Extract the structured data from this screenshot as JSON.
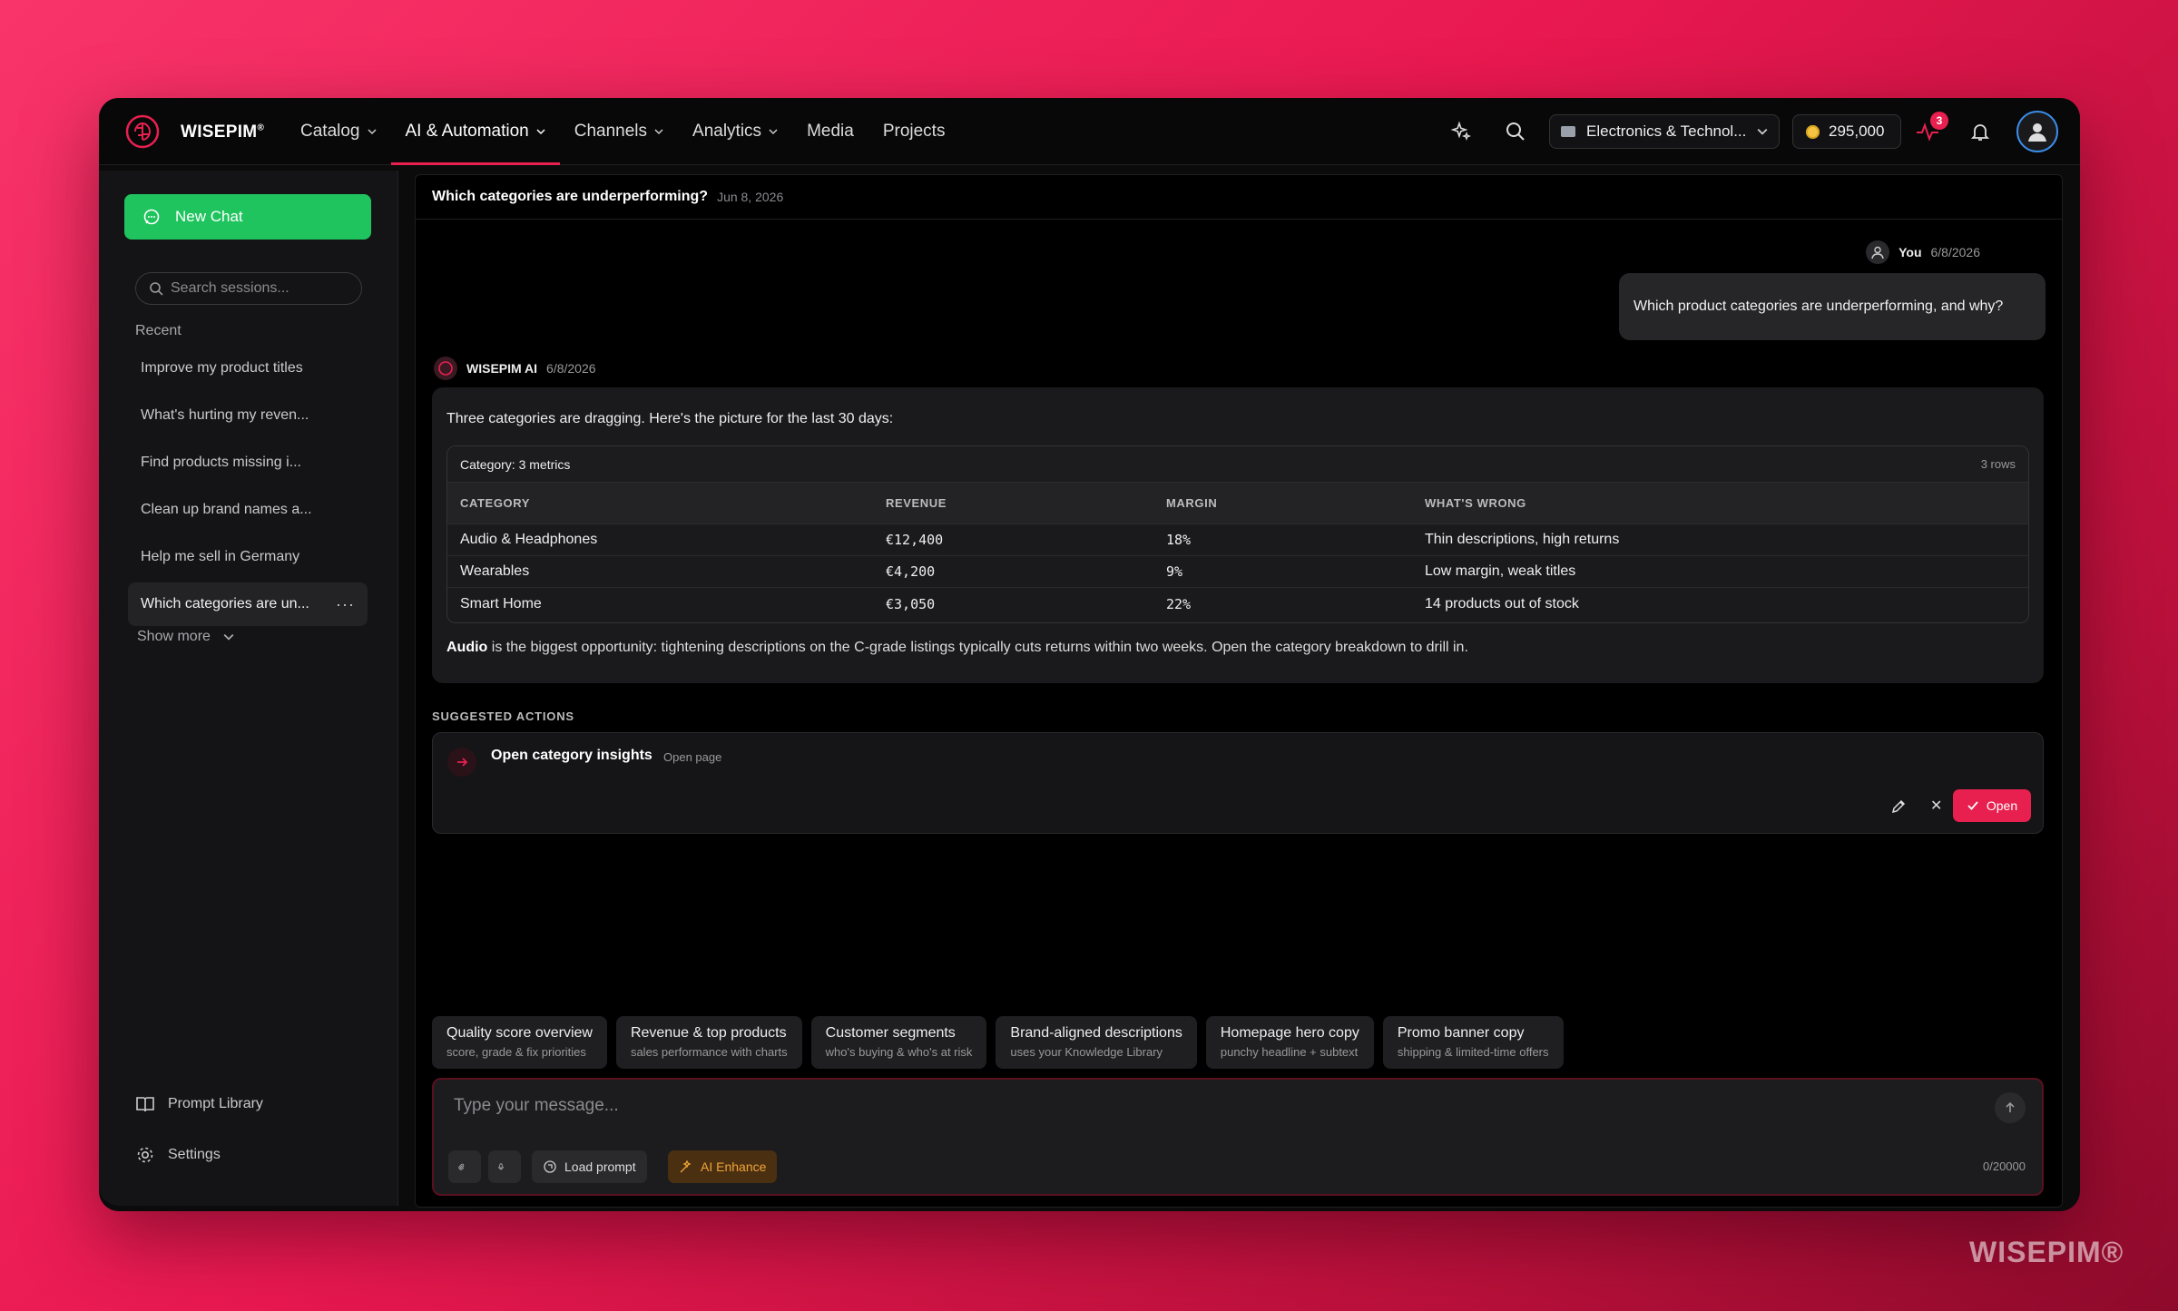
{
  "app": {
    "brand": "WISEPIM",
    "brand_mark": "®",
    "watermark": "WISEPIM®"
  },
  "nav": {
    "items": [
      {
        "label": "Catalog",
        "has_menu": true,
        "active": false
      },
      {
        "label": "AI & Automation",
        "has_menu": true,
        "active": true
      },
      {
        "label": "Channels",
        "has_menu": true,
        "active": false
      },
      {
        "label": "Analytics",
        "has_menu": true,
        "active": false
      },
      {
        "label": "Media",
        "has_menu": false,
        "active": false
      },
      {
        "label": "Projects",
        "has_menu": false,
        "active": false
      }
    ],
    "workspace": "Electronics & Technol...",
    "credits": "295,000",
    "notifications_badge": "3",
    "accent_color": "#e8204f"
  },
  "sidebar": {
    "new_chat": "New Chat",
    "search_placeholder": "Search sessions...",
    "recent_label": "Recent",
    "sessions": [
      "Improve my product titles",
      "What's hurting my reven...",
      "Find products missing i...",
      "Clean up brand names a...",
      "Help me sell in Germany",
      "Which categories are un..."
    ],
    "session_menu": "···",
    "show_more": "Show more",
    "prompt_library": "Prompt Library",
    "settings": "Settings"
  },
  "chat": {
    "title": "Which categories are underperforming?",
    "date": "Jun 8, 2026",
    "user": {
      "name": "You",
      "date": "6/8/2026",
      "message": "Which product categories are underperforming, and why?"
    },
    "ai": {
      "name": "WISEPIM AI",
      "date": "6/8/2026",
      "intro": "Three categories are dragging. Here's the picture for the last 30 days:",
      "table": {
        "title": "Category: 3 metrics",
        "row_count": "3 rows",
        "headers": [
          "CATEGORY",
          "REVENUE",
          "MARGIN",
          "WHAT'S WRONG"
        ],
        "rows": [
          [
            "Audio & Headphones",
            "€12,400",
            "18%",
            "Thin descriptions, high returns"
          ],
          [
            "Wearables",
            "€4,200",
            "9%",
            "Low margin, weak titles"
          ],
          [
            "Smart Home",
            "€3,050",
            "22%",
            "14 products out of stock"
          ]
        ]
      },
      "outro_bold": "Audio",
      "outro_rest": " is the biggest opportunity: tightening descriptions on the C-grade listings typically cuts returns within two weeks. Open the category breakdown to drill in."
    },
    "suggested": {
      "label": "SUGGESTED ACTIONS",
      "title": "Open category insights",
      "sub": "Open page",
      "open": "Open"
    },
    "chips": [
      {
        "label": "Quality score overview",
        "sub": "score, grade & fix priorities"
      },
      {
        "label": "Revenue & top products",
        "sub": "sales performance with charts"
      },
      {
        "label": "Customer segments",
        "sub": "who's buying & who's at risk"
      },
      {
        "label": "Brand-aligned descriptions",
        "sub": "uses your Knowledge Library"
      },
      {
        "label": "Homepage hero copy",
        "sub": "punchy headline + subtext"
      },
      {
        "label": "Promo banner copy",
        "sub": "shipping & limited-time offers"
      }
    ],
    "composer": {
      "placeholder": "Type your message...",
      "load_prompt": "Load prompt",
      "ai_enhance": "AI Enhance",
      "counter": "0/20000"
    }
  }
}
